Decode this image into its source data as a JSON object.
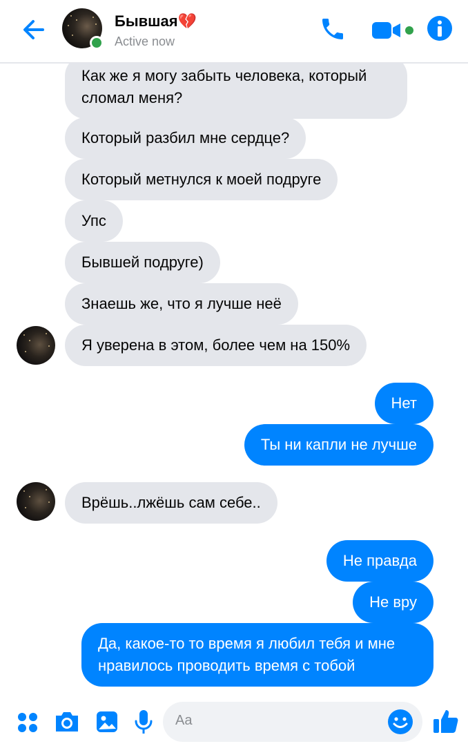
{
  "header": {
    "contact_name": "Бывшая💔",
    "status": "Active now"
  },
  "messages": [
    {
      "side": "in",
      "text": "Как же я могу забыть человека, который сломал меня?"
    },
    {
      "side": "in",
      "text": "Который разбил мне сердце?"
    },
    {
      "side": "in",
      "text": "Который метнулся к моей подруге"
    },
    {
      "side": "in",
      "text": "Упс"
    },
    {
      "side": "in",
      "text": "Бывшей подруге)"
    },
    {
      "side": "in",
      "text": "Знаешь же, что я лучше неё"
    },
    {
      "side": "in",
      "text": "Я уверена в этом, более чем на 150%"
    },
    {
      "side": "out",
      "text": "Нет"
    },
    {
      "side": "out",
      "text": "Ты ни капли не лучше"
    },
    {
      "side": "in",
      "text": "Врёшь..лжёшь сам себе.."
    },
    {
      "side": "out",
      "text": "Не правда"
    },
    {
      "side": "out",
      "text": "Не вру"
    },
    {
      "side": "out",
      "text": "Да, какое-то то время я любил тебя и мне нравилось проводить время с тобой"
    }
  ],
  "composer": {
    "placeholder": "Aa"
  },
  "colors": {
    "accent": "#0084ff",
    "incoming_bubble": "#e4e6eb",
    "presence": "#31a24c"
  },
  "icons": [
    "back-arrow-icon",
    "phone-icon",
    "video-camera-icon",
    "info-icon",
    "apps-grid-icon",
    "camera-icon",
    "image-icon",
    "microphone-icon",
    "emoji-icon",
    "thumbs-up-icon"
  ]
}
